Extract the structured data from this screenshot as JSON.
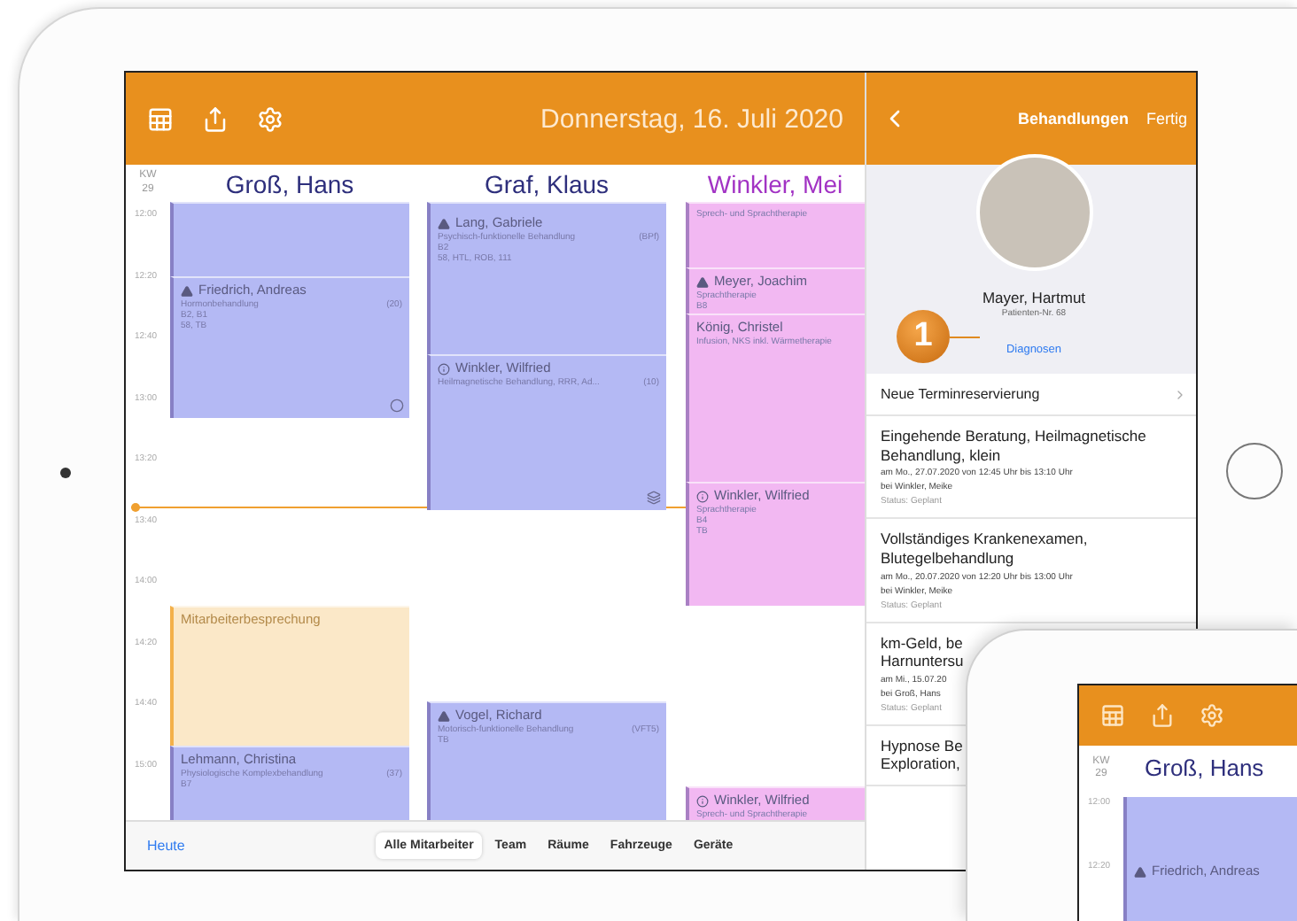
{
  "toolbar": {
    "title": "Donnerstag, 16. Juli 2020"
  },
  "calendar": {
    "week_label": "KW",
    "week": "29",
    "times": [
      "12:00",
      "12:20",
      "12:40",
      "13:00",
      "13:20",
      "13:40",
      "14:00",
      "14:20",
      "14:40",
      "15:00"
    ],
    "columns": [
      {
        "name": "Groß, Hans",
        "color": "#2e2f7c",
        "events": [
          {
            "kind": "blank",
            "color": "#b4b9f4"
          },
          {
            "kind": "flagged",
            "color": "#b4b9f4",
            "name": "Friedrich, Andreas",
            "detail": "Hormonbehandlung",
            "code": "(20)",
            "lines": [
              "B2, B1",
              "58, TB"
            ]
          },
          {
            "kind": "meeting",
            "color": "#fbe8c8",
            "name": "Mitarbeiterbesprechung"
          },
          {
            "kind": "appointment",
            "color": "#b4b9f4",
            "name": "Lehmann, Christina",
            "detail": "Physiologische Komplexbehandlung",
            "code": "(37)",
            "lines": [
              "B7"
            ]
          }
        ]
      },
      {
        "name": "Graf, Klaus",
        "color": "#2e2f7c",
        "events": [
          {
            "kind": "flagged",
            "color": "#b4b9f4",
            "name": "Lang, Gabriele",
            "detail": "Psychisch-funktionelle Behandlung",
            "code": "(BPf)",
            "lines": [
              "B2",
              "58, HTL, ROB, 111"
            ]
          },
          {
            "kind": "info",
            "color": "#b4b9f4",
            "name": "Winkler, Wilfried",
            "detail": "Heilmagnetische Behandlung, RRR, Ad...",
            "code": "(10)"
          },
          {
            "kind": "flagged",
            "color": "#b4b9f4",
            "name": "Vogel, Richard",
            "detail": "Motorisch-funktionelle Behandlung",
            "code": "(VFT5)",
            "lines": [
              "TB"
            ]
          }
        ]
      },
      {
        "name": "Winkler, Mei",
        "color": "#a233c4",
        "events": [
          {
            "kind": "appointment",
            "color": "#f2b8f2",
            "detail": "Sprech- und Sprachtherapie"
          },
          {
            "kind": "flagged",
            "color": "#f2b8f2",
            "name": "Meyer, Joachim",
            "detail": "Sprachtherapie",
            "lines": [
              "B8"
            ]
          },
          {
            "kind": "appointment",
            "color": "#f2b8f2",
            "name": "König, Christel",
            "detail": "Infusion, NKS inkl. Wärmetherapie"
          },
          {
            "kind": "info",
            "color": "#f2b8f2",
            "name": "Winkler, Wilfried",
            "detail": "Sprachtherapie",
            "lines": [
              "B4",
              "TB"
            ]
          },
          {
            "kind": "info",
            "color": "#f2b8f2",
            "name": "Winkler, Wilfried",
            "detail": "Sprech- und Sprachtherapie"
          }
        ]
      }
    ]
  },
  "bottom_bar": {
    "today": "Heute",
    "segments": [
      {
        "label": "Alle Mitarbeiter",
        "selected": true
      },
      {
        "label": "Team",
        "selected": false
      },
      {
        "label": "Räume",
        "selected": false
      },
      {
        "label": "Fahrzeuge",
        "selected": false
      },
      {
        "label": "Geräte",
        "selected": false
      }
    ]
  },
  "panel": {
    "title": "Behandlungen",
    "done": "Fertig",
    "patient_name": "Mayer, Hartmut",
    "patient_number": "Patienten-Nr. 68",
    "link": "Diagnosen",
    "callout": "1",
    "new_entry": "Neue Terminreservierung",
    "treatments": [
      {
        "title": [
          "Eingehende Beratung, Heilmagnetische",
          "Behandlung, klein"
        ],
        "date": "am Mo., 27.07.2020 von 12:45 Uhr bis 13:10 Uhr",
        "staff": "bei Winkler, Meike",
        "status": "Status: Geplant"
      },
      {
        "title": [
          "Vollständiges Krankenexamen,",
          "Blutegelbehandlung"
        ],
        "date": "am Mo., 20.07.2020 von 12:20 Uhr bis 13:00 Uhr",
        "staff": "bei Winkler, Meike",
        "status": "Status: Geplant"
      },
      {
        "title": [
          "km-Geld, be",
          "Harnuntersu"
        ],
        "date": "am Mi., 15.07.20",
        "staff": "bei Groß, Hans",
        "status": "Status: Geplant"
      },
      {
        "title": [
          "Hypnose Be",
          "Exploration,"
        ]
      }
    ]
  },
  "mini_device": {
    "week_label": "KW",
    "week": "29",
    "column": "Groß, Hans",
    "times": [
      "12:00",
      "12:20"
    ],
    "event": "Friedrich, Andreas"
  }
}
